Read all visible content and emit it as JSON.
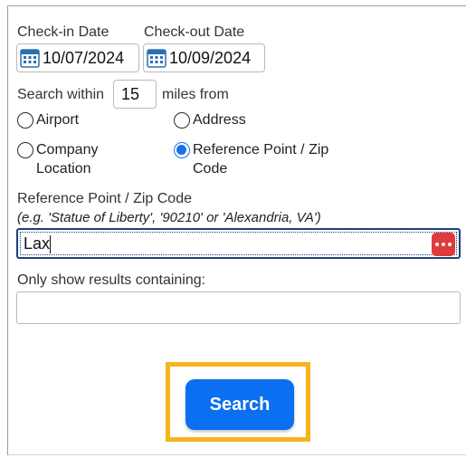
{
  "dates": {
    "checkin_label": "Check-in Date",
    "checkout_label": "Check-out Date",
    "checkin_value": "10/07/2024",
    "checkout_value": "10/09/2024"
  },
  "search_within": {
    "prefix": "Search within",
    "value": "15",
    "suffix": "miles from"
  },
  "radios": {
    "airport": "Airport",
    "address": "Address",
    "company_line1": "Company",
    "company_line2": "Location",
    "refpoint_line1": "Reference Point / Zip",
    "refpoint_line2": "Code",
    "selected": "Reference Point / Zip Code"
  },
  "reference": {
    "label": "Reference Point / Zip Code",
    "hint": "(e.g. 'Statue of Liberty', '90210' or 'Alexandria, VA')",
    "value": "Lax"
  },
  "filter": {
    "label": "Only show results containing:",
    "value": ""
  },
  "search_button": "Search",
  "colors": {
    "accent": "#1a73e8",
    "button": "#0a6ff0",
    "highlight": "#f3b51b",
    "password_badge": "#e03b3b"
  },
  "icons": {
    "calendar": "calendar-icon",
    "password_manager": "password-manager-icon"
  }
}
